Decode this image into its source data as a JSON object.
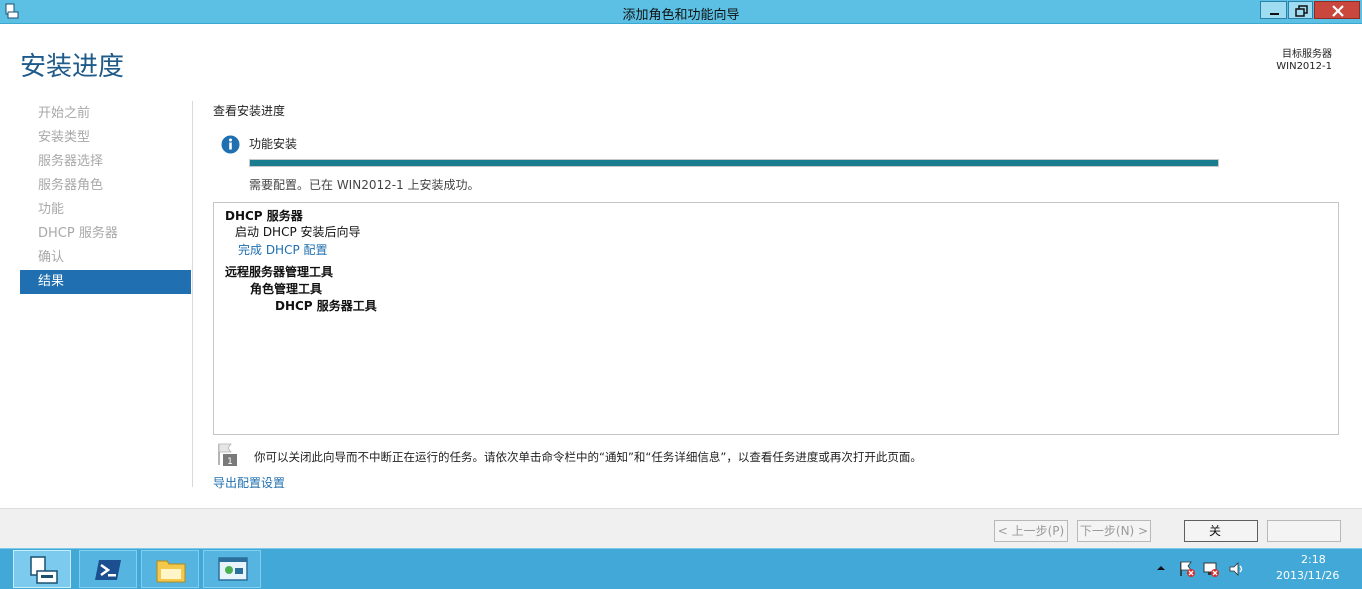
{
  "window": {
    "title": "添加角色和功能向导"
  },
  "header": {
    "page_title": "安装进度",
    "target_label": "目标服务器",
    "target_server": "WIN2012-1"
  },
  "nav": {
    "items": [
      {
        "label": "开始之前"
      },
      {
        "label": "安装类型"
      },
      {
        "label": "服务器选择"
      },
      {
        "label": "服务器角色"
      },
      {
        "label": "功能"
      },
      {
        "label": "DHCP 服务器"
      },
      {
        "label": "确认"
      },
      {
        "label": "结果"
      }
    ],
    "active_index": 7
  },
  "content": {
    "section_title": "查看安装进度",
    "feature_label": "功能安装",
    "progress_fraction": 1.0,
    "status_text": "需要配置。已在 WIN2012-1 上安装成功。",
    "results": {
      "dhcp_title": "DHCP 服务器",
      "dhcp_sub": "启动 DHCP 安装后向导",
      "dhcp_link": "完成 DHCP 配置",
      "rsat_title": "远程服务器管理工具",
      "rsat_role": "角色管理工具",
      "rsat_dhcp": "DHCP 服务器工具"
    },
    "note": "你可以关闭此向导而不中断正在运行的任务。请依次单击命令栏中的“通知”和“任务详细信息”，以查看任务进度或再次打开此页面。",
    "flag_badge": "1",
    "export_link": "导出配置设置"
  },
  "footer": {
    "prev_label": "< 上一步(P)",
    "next_label": "下一步(N) >",
    "close_label": "关",
    "cancel_label": ""
  },
  "taskbar": {
    "time": "2:18",
    "date": "2013/11/26"
  },
  "colors": {
    "accent": "#1f6fb1",
    "progress": "#1a7c8f",
    "titlebar": "#5bc0e3",
    "taskbar": "#42a8d8"
  }
}
